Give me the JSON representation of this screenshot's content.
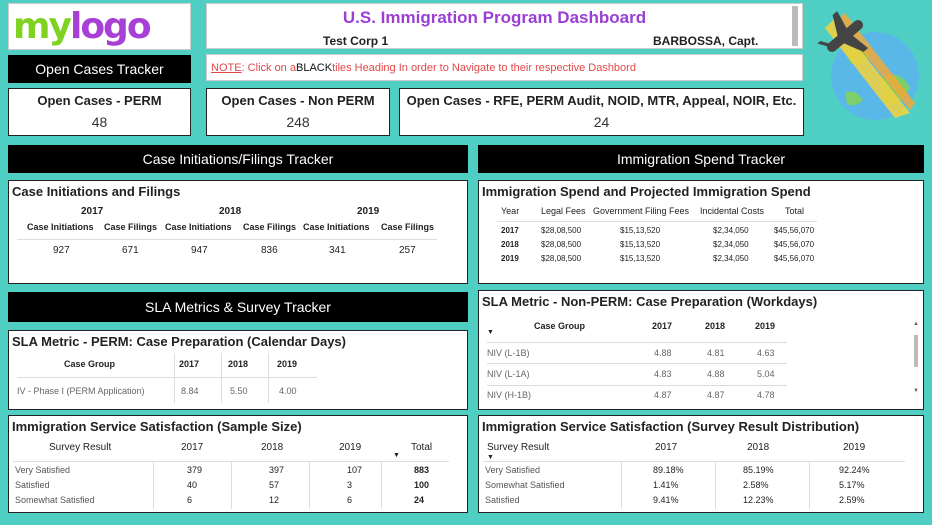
{
  "logo": {
    "text_my": "my",
    "text_logo": "logo"
  },
  "header": {
    "title": "U.S. Immigration Program Dashboard",
    "company": "Test Corp 1",
    "user": "BARBOSSA, Capt."
  },
  "note": {
    "prefix": "NOTE",
    "text1": " : Click on a ",
    "black": "BLACK",
    "text2": " tiles Heading In order to Navigate to their respective Dashbord"
  },
  "tiles": {
    "open_cases": "Open Cases Tracker",
    "initiations": "Case Initiations/Filings Tracker",
    "spend": "Immigration Spend Tracker",
    "sla": "SLA Metrics & Survey Tracker"
  },
  "kpis": [
    {
      "label": "Open Cases - PERM",
      "value": "48"
    },
    {
      "label": "Open Cases - Non PERM",
      "value": "248"
    },
    {
      "label": "Open Cases - RFE, PERM Audit, NOID, MTR, Appeal, NOIR, Etc.",
      "value": "24"
    }
  ],
  "initiations": {
    "title": "Case Initiations and Filings",
    "years": [
      "2017",
      "2018",
      "2019"
    ],
    "col_initiations": "Case Initiations",
    "col_filings": "Case Filings",
    "values": [
      "927",
      "671",
      "947",
      "836",
      "341",
      "257"
    ]
  },
  "spend": {
    "title": "Immigration Spend and Projected Immigration Spend",
    "headers": [
      "Year",
      "Legal Fees",
      "Government Filing Fees",
      "Incidental Costs",
      "Total"
    ],
    "rows": [
      [
        "2017",
        "$28,08,500",
        "$15,13,520",
        "$2,34,050",
        "$45,56,070"
      ],
      [
        "2018",
        "$28,08,500",
        "$15,13,520",
        "$2,34,050",
        "$45,56,070"
      ],
      [
        "2019",
        "$28,08,500",
        "$15,13,520",
        "$2,34,050",
        "$45,56,070"
      ]
    ]
  },
  "sla_perm": {
    "title": "SLA Metric - PERM: Case Preparation (Calendar Days)",
    "headers": [
      "Case Group",
      "2017",
      "2018",
      "2019"
    ],
    "rows": [
      [
        "IV - Phase I (PERM Application)",
        "8.84",
        "5.50",
        "4.00"
      ]
    ]
  },
  "sla_nonperm": {
    "title": "SLA Metric - Non-PERM: Case Preparation (Workdays)",
    "headers": [
      "Case Group",
      "2017",
      "2018",
      "2019"
    ],
    "rows": [
      [
        "NIV (L-1B)",
        "4.88",
        "4.81",
        "4.63"
      ],
      [
        "NIV (L-1A)",
        "4.83",
        "4.88",
        "5.04"
      ],
      [
        "NIV (H-1B)",
        "4.87",
        "4.87",
        "4.78"
      ]
    ]
  },
  "satisfaction": {
    "title": "Immigration Service Satisfaction (Sample Size)",
    "headers": [
      "Survey Result",
      "2017",
      "2018",
      "2019",
      "Total"
    ],
    "rows": [
      [
        "Very Satisfied",
        "379",
        "397",
        "107",
        "883"
      ],
      [
        "Satisfied",
        "40",
        "57",
        "3",
        "100"
      ],
      [
        "Somewhat Satisfied",
        "6",
        "12",
        "6",
        "24"
      ]
    ]
  },
  "distribution": {
    "title": "Immigration Service Satisfaction (Survey Result Distribution)",
    "headers": [
      "Survey Result",
      "2017",
      "2018",
      "2019"
    ],
    "rows": [
      [
        "Very Satisfied",
        "89.18%",
        "85.19%",
        "92.24%"
      ],
      [
        "Somewhat Satisfied",
        "1.41%",
        "2.58%",
        "5.17%"
      ],
      [
        "Satisfied",
        "9.41%",
        "12.23%",
        "2.59%"
      ]
    ]
  },
  "colors": {
    "background": "#4fcfc4",
    "title_purple": "#9b3fd4",
    "note_red": "#e04848"
  },
  "icons": {
    "plane_globe": "airplane-globe-icon"
  }
}
